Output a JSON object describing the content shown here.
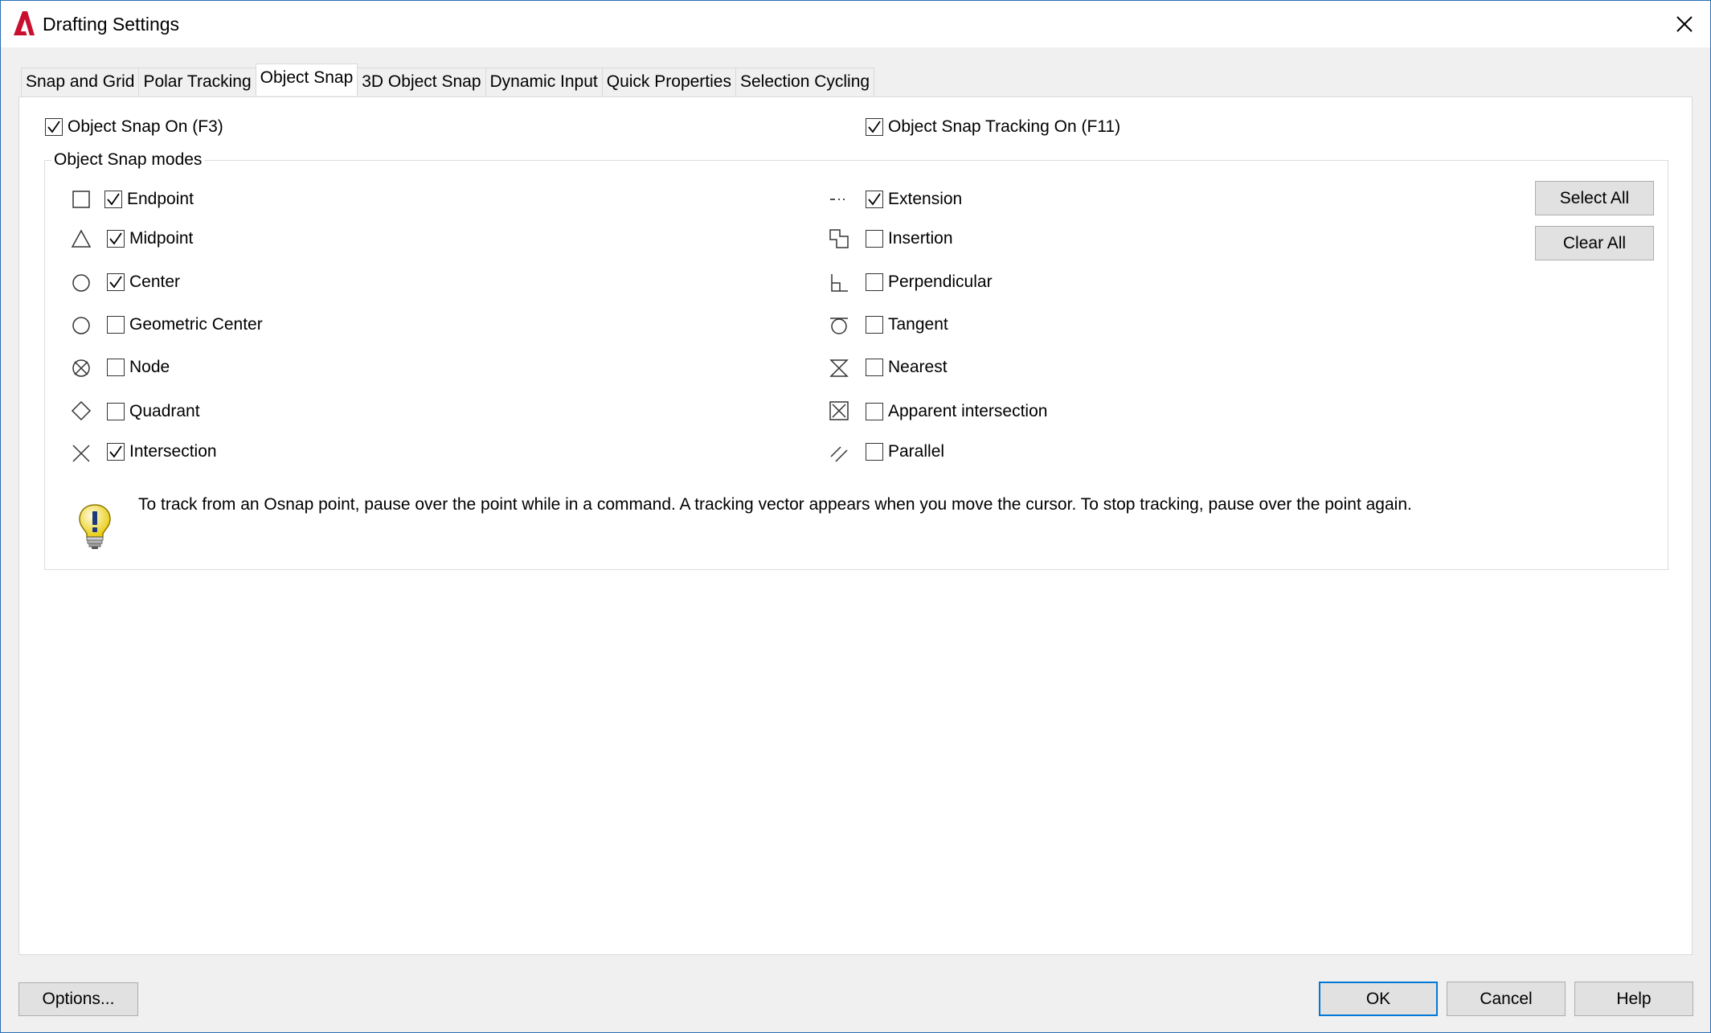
{
  "window": {
    "title": "Drafting Settings"
  },
  "tabs": [
    {
      "label": "Snap and Grid",
      "active": false
    },
    {
      "label": "Polar Tracking",
      "active": false
    },
    {
      "label": "Object Snap",
      "active": true
    },
    {
      "label": "3D Object Snap",
      "active": false
    },
    {
      "label": "Dynamic Input",
      "active": false
    },
    {
      "label": "Quick Properties",
      "active": false
    },
    {
      "label": "Selection Cycling",
      "active": false
    }
  ],
  "object_snap_on": {
    "label": "Object Snap On (F3)",
    "checked": true
  },
  "object_snap_tracking_on": {
    "label": "Object Snap Tracking On (F11)",
    "checked": true
  },
  "modes": {
    "group_label": "Object Snap modes",
    "left": [
      {
        "label": "Endpoint",
        "checked": true,
        "icon": "endpoint-icon"
      },
      {
        "label": "Midpoint",
        "checked": true,
        "icon": "midpoint-icon"
      },
      {
        "label": "Center",
        "checked": true,
        "icon": "center-icon"
      },
      {
        "label": "Geometric Center",
        "checked": false,
        "icon": "geometric-center-icon"
      },
      {
        "label": "Node",
        "checked": false,
        "icon": "node-icon"
      },
      {
        "label": "Quadrant",
        "checked": false,
        "icon": "quadrant-icon"
      },
      {
        "label": "Intersection",
        "checked": true,
        "icon": "intersection-icon"
      }
    ],
    "right": [
      {
        "label": "Extension",
        "checked": true,
        "icon": "extension-icon"
      },
      {
        "label": "Insertion",
        "checked": false,
        "icon": "insertion-icon"
      },
      {
        "label": "Perpendicular",
        "checked": false,
        "icon": "perpendicular-icon"
      },
      {
        "label": "Tangent",
        "checked": false,
        "icon": "tangent-icon"
      },
      {
        "label": "Nearest",
        "checked": false,
        "icon": "nearest-icon"
      },
      {
        "label": "Apparent intersection",
        "checked": false,
        "icon": "apparent-intersection-icon"
      },
      {
        "label": "Parallel",
        "checked": false,
        "icon": "parallel-icon"
      }
    ],
    "select_all_label": "Select All",
    "clear_all_label": "Clear All"
  },
  "tip": {
    "text": "To track from an Osnap point, pause over the point while in a command.  A tracking vector appears when you move the cursor.  To stop tracking, pause over the point again.",
    "icon": "lightbulb-icon"
  },
  "footer": {
    "options_label": "Options...",
    "ok_label": "OK",
    "cancel_label": "Cancel",
    "help_label": "Help"
  },
  "colors": {
    "logo_red": "#c8102e",
    "default_button_border": "#0078d7"
  }
}
